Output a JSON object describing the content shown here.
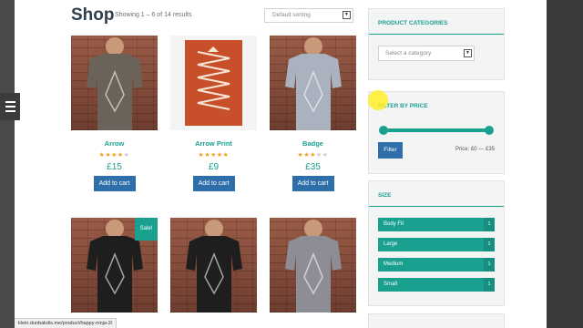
{
  "header": {
    "title": "Shop",
    "result_count": "Showing 1 – 6 of 14 results",
    "sort": {
      "value": "Default sorting"
    }
  },
  "products": [
    {
      "name": "Arrow",
      "rating": 4,
      "price": "£15",
      "button": "Add to cart",
      "shirt_color": "#6b6359",
      "sale": ""
    },
    {
      "name": "Arrow Print",
      "rating": 5,
      "price": "£9",
      "button": "Add to cart",
      "shirt_color": "#c7502a",
      "sale": ""
    },
    {
      "name": "Badge",
      "rating": 3,
      "price": "£35",
      "button": "Add to cart",
      "shirt_color": "#aab2c0",
      "sale": ""
    },
    {
      "name": "",
      "rating": 0,
      "price": "",
      "button": "",
      "shirt_color": "#1e1e1e",
      "sale": "Sale!"
    },
    {
      "name": "",
      "rating": 0,
      "price": "",
      "button": "",
      "shirt_color": "#1e1e1e",
      "sale": ""
    },
    {
      "name": "",
      "rating": 0,
      "price": "",
      "button": "",
      "shirt_color": "#8d8d96",
      "sale": ""
    }
  ],
  "sidebar": {
    "categories": {
      "title": "PRODUCT CATEGORIES",
      "select_value": "Select a category"
    },
    "price_filter": {
      "title": "FILTER BY PRICE",
      "button": "Filter",
      "range_text": "Price: £0 — £35"
    },
    "size": {
      "title": "SIZE",
      "items": [
        {
          "label": "Body Fit",
          "count": "1"
        },
        {
          "label": "Large",
          "count": "1"
        },
        {
          "label": "Medium",
          "count": "1"
        },
        {
          "label": "Small",
          "count": "1"
        }
      ]
    }
  },
  "status_bar": {
    "url": "klein.dunbakdis.me/product/happy-ninja-2/"
  },
  "colors": {
    "accent": "#1aa08f",
    "button": "#2e6ea9",
    "title": "#2f3e4d"
  }
}
